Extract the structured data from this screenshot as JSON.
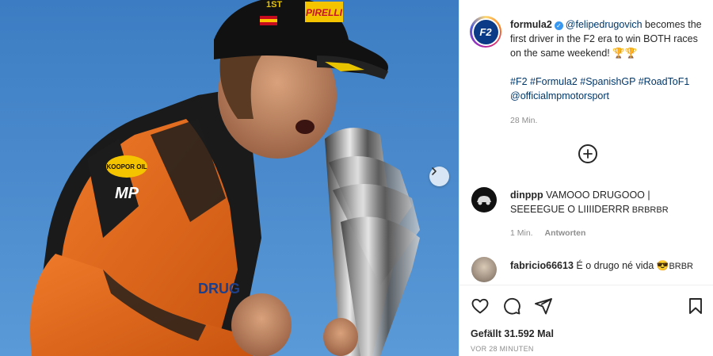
{
  "photo": {
    "badge_top": "1ST",
    "cap_brand": "PIRELLI",
    "suit_sponsors": [
      "KOOPOR OIL",
      "MP",
      "DRUG"
    ]
  },
  "post": {
    "username": "formula2",
    "avatar_text": "F2",
    "caption_mention": "@felipedrugovich",
    "caption_text": " becomes the first driver in the F2 era to win BOTH races on the same weekend! 🏆🏆",
    "hashtags": [
      "#F2",
      "#Formula2",
      "#SpanishGP",
      "#RoadToF1"
    ],
    "account_mention": "@officialmpmotorsport",
    "time": "28 Min."
  },
  "comments": [
    {
      "username": "dinppp",
      "text": " VAMOOO DRUGOOO | SEEEEGUE O LIIIIDERRR",
      "suffix": " BRBRBR",
      "time": "1 Min.",
      "reply_label": "Antworten"
    },
    {
      "username": "fabricio66613",
      "text": " É o drugo né vida ",
      "emoji": "😎",
      "suffix": "BRBR"
    }
  ],
  "actions": {
    "likes": "Gefällt 31.592 Mal",
    "ago": "VOR 28 MINUTEN"
  },
  "colors": {
    "link": "#00376b",
    "meta": "#8e8e8e",
    "verified": "#3897f0"
  }
}
